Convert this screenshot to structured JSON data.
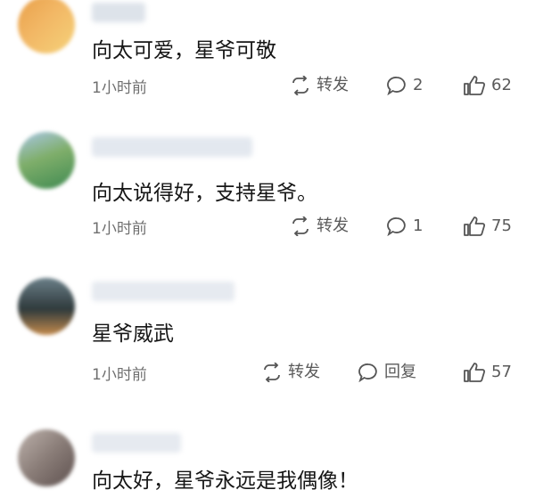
{
  "comments": [
    {
      "text": "向太可爱，星爷可敬",
      "time": "1小时前",
      "repost_label": "转发",
      "reply_value": "2",
      "like_count": "62",
      "avatar_colors": [
        "#f2b765",
        "#e9a04a",
        "#f5d27a"
      ]
    },
    {
      "text": "向太说得好，支持星爷。",
      "time": "1小时前",
      "repost_label": "转发",
      "reply_value": "1",
      "like_count": "75",
      "avatar_colors": [
        "#3f8a52",
        "#7fae6a",
        "#a9c7e8"
      ]
    },
    {
      "text": "星爷威武",
      "time": "1小时前",
      "repost_label": "转发",
      "reply_value": "回复",
      "like_count": "57",
      "avatar_colors": [
        "#2f3a3c",
        "#6a7f88",
        "#c48b4d"
      ]
    },
    {
      "text": "向太好，星爷永远是我偶像！",
      "time": "",
      "repost_label": "",
      "reply_value": "",
      "like_count": "",
      "avatar_colors": [
        "#8a7d78",
        "#bdb2ac",
        "#5e514f"
      ]
    }
  ]
}
